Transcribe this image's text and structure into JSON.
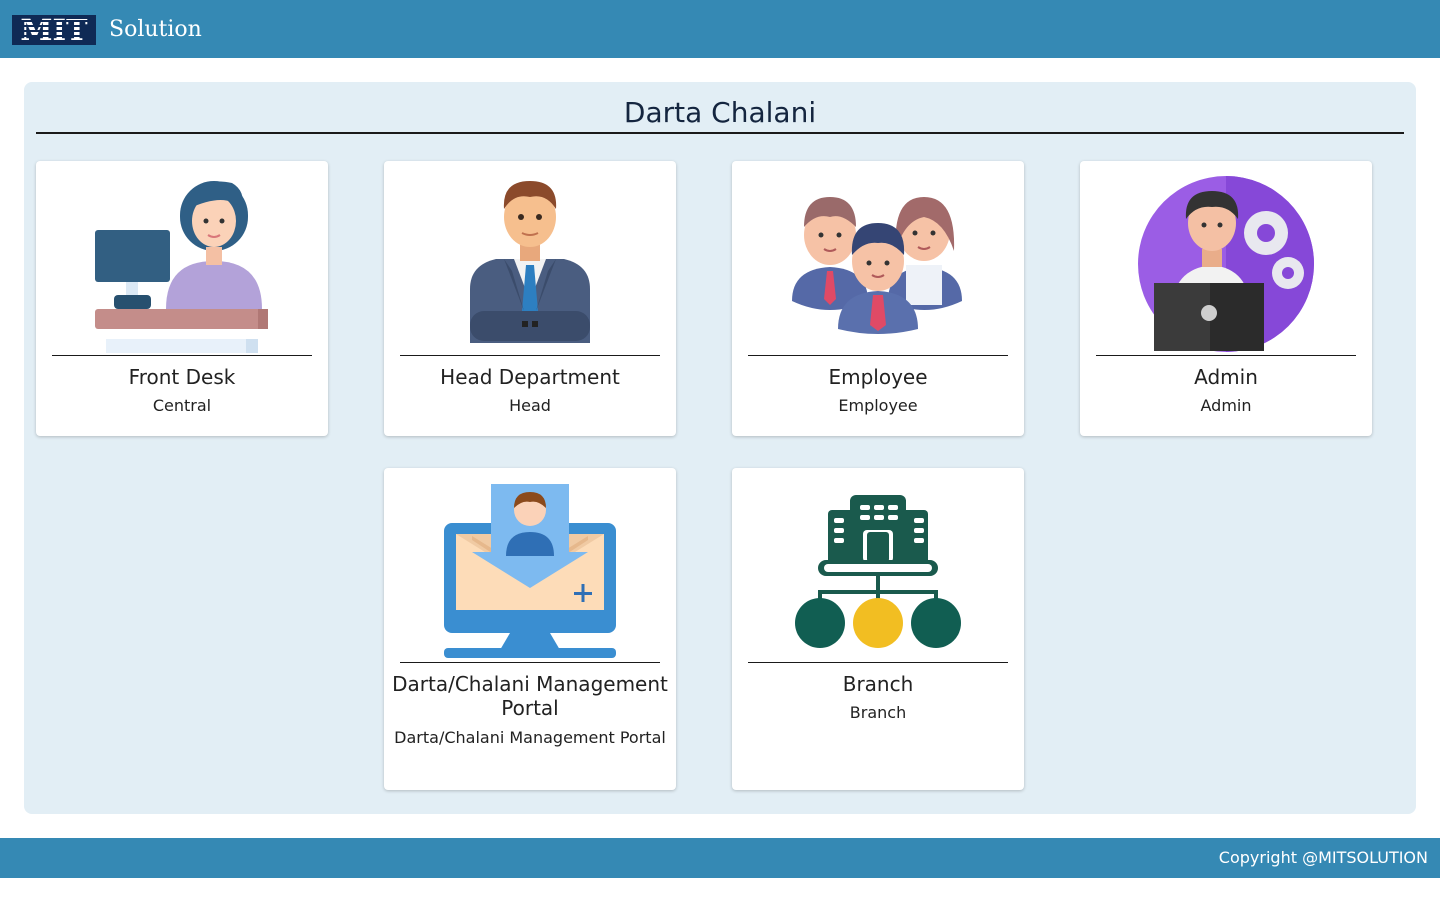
{
  "header": {
    "logo_mark": "MIT",
    "logo_text": "Solution"
  },
  "main": {
    "title": "Darta Chalani"
  },
  "cards": [
    {
      "title": "Front Desk",
      "subtitle": "Central",
      "icon": "front-desk-icon"
    },
    {
      "title": "Head Department",
      "subtitle": "Head",
      "icon": "businessman-icon"
    },
    {
      "title": "Employee",
      "subtitle": "Employee",
      "icon": "employees-group-icon"
    },
    {
      "title": "Admin",
      "subtitle": "Admin",
      "icon": "admin-gear-icon"
    },
    {
      "title": "Darta/Chalani Management Portal",
      "subtitle": "Darta/Chalani Management Portal",
      "icon": "monitor-mail-icon"
    },
    {
      "title": "Branch",
      "subtitle": "Branch",
      "icon": "branch-hierarchy-icon"
    }
  ],
  "footer": {
    "copyright": "Copyright @MITSOLUTION"
  },
  "colors": {
    "brand": "#3589b4",
    "panel": "#e2eef5",
    "title": "#14253f"
  }
}
